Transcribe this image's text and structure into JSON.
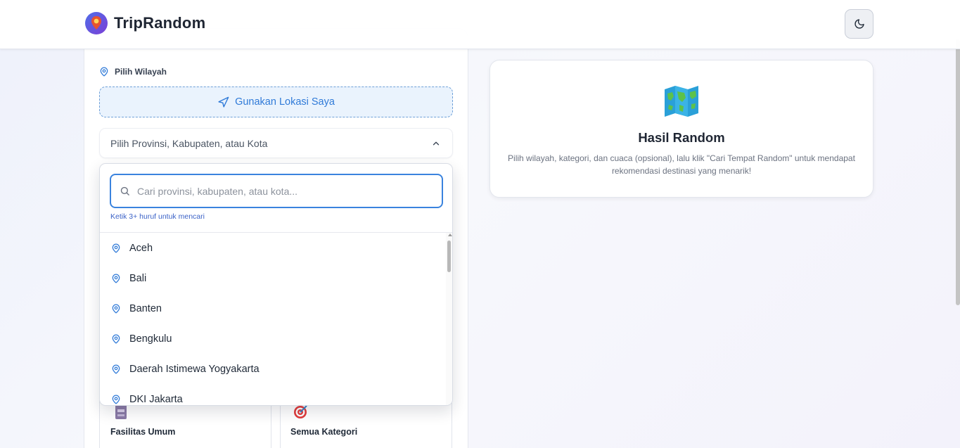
{
  "header": {
    "app_title": "TripRandom",
    "theme_toggle_icon": "moon-icon"
  },
  "location": {
    "section_label": "Pilih Wilayah",
    "geo_button_label": "Gunakan Lokasi Saya",
    "select_placeholder": "Pilih Provinsi, Kabupaten, atau Kota",
    "search_placeholder": "Cari provinsi, kabupaten, atau kota...",
    "search_value": "",
    "hint": "Ketik 3+ huruf untuk mencari",
    "options": [
      {
        "label": "Aceh"
      },
      {
        "label": "Bali"
      },
      {
        "label": "Banten"
      },
      {
        "label": "Bengkulu"
      },
      {
        "label": "Daerah Istimewa Yogyakarta"
      },
      {
        "label": "DKI Jakarta"
      }
    ]
  },
  "categories": [
    {
      "label": "Fasilitas Umum",
      "icon": "atm-icon"
    },
    {
      "label": "Semua Kategori",
      "icon": "target-icon"
    }
  ],
  "result": {
    "icon": "world-map-icon",
    "title": "Hasil Random",
    "description": "Pilih wilayah, kategori, dan cuaca (opsional), lalu klik \"Cari Tempat Random\" untuk mendapat rekomendasi destinasi yang menarik!"
  },
  "colors": {
    "accent": "#3a83de",
    "geo_button_bg": "#eaf3fd",
    "hint_text": "#3c63c7"
  }
}
